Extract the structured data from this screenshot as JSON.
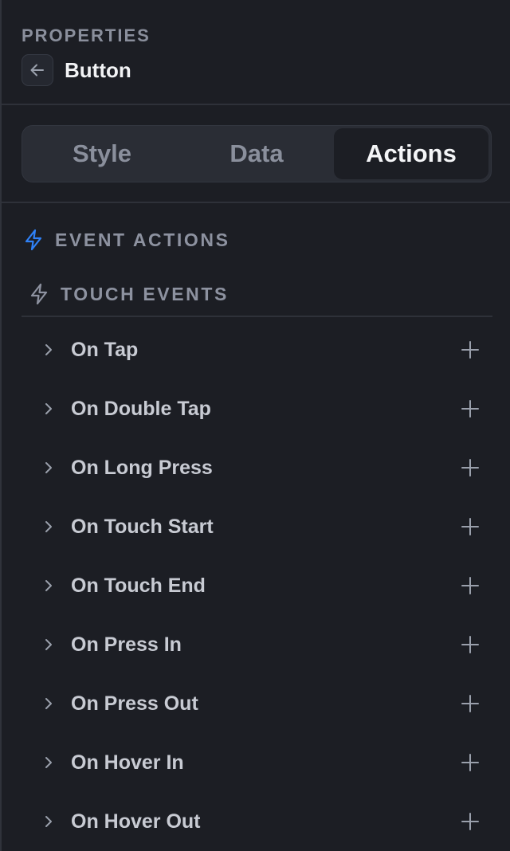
{
  "header": {
    "overline": "PROPERTIES",
    "title": "Button"
  },
  "tabs": [
    {
      "label": "Style",
      "active": false
    },
    {
      "label": "Data",
      "active": false
    },
    {
      "label": "Actions",
      "active": true
    }
  ],
  "section": {
    "title": "EVENT ACTIONS",
    "icon": "lightning-icon",
    "accent": "#2f81f7"
  },
  "group": {
    "title": "TOUCH EVENTS",
    "icon": "lightning-icon"
  },
  "events": [
    {
      "label": "On Tap"
    },
    {
      "label": "On Double Tap"
    },
    {
      "label": "On Long Press"
    },
    {
      "label": "On Touch Start"
    },
    {
      "label": "On Touch End"
    },
    {
      "label": "On Press In"
    },
    {
      "label": "On Press Out"
    },
    {
      "label": "On Hover In"
    },
    {
      "label": "On Hover Out"
    }
  ]
}
